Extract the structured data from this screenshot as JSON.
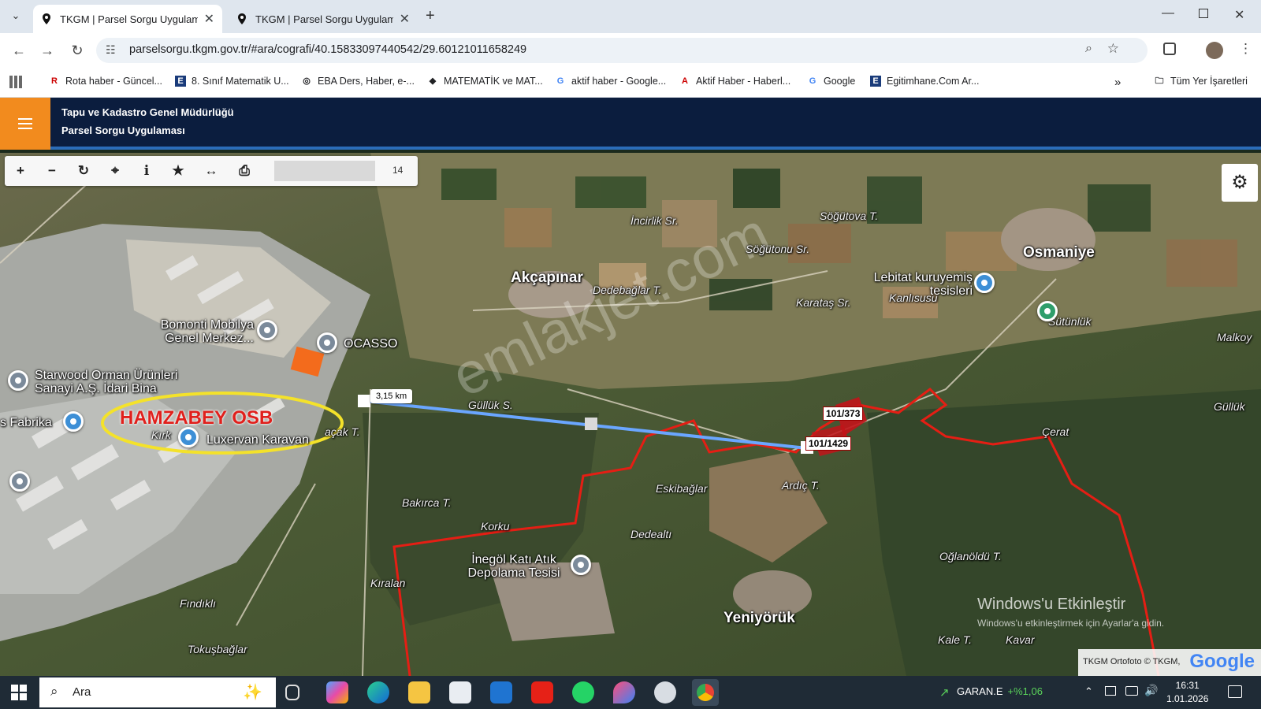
{
  "browser": {
    "tabs": [
      {
        "title": "TKGM | Parsel Sorgu Uygulama",
        "active": true
      },
      {
        "title": "TKGM | Parsel Sorgu Uygulama",
        "active": false
      }
    ],
    "new_tab_label": "+",
    "url": "parselsorgu.tkgm.gov.tr/#ara/cografi/40.15833097440542/29.60121011658249",
    "bookmarks": [
      {
        "label": "Rota haber - Güncel..."
      },
      {
        "label": "8. Sınıf Matematik U..."
      },
      {
        "label": "EBA Ders, Haber, e-..."
      },
      {
        "label": "MATEMATİK ve MAT..."
      },
      {
        "label": "aktif haber - Google..."
      },
      {
        "label": "Aktif Haber - Haberl..."
      },
      {
        "label": "Google"
      },
      {
        "label": "Egitimhane.Com Ar..."
      }
    ],
    "all_bookmarks_label": "Tüm Yer İşaretleri",
    "overflow_label": "»"
  },
  "app": {
    "org": "Tapu ve Kadastro Genel Müdürlüğü",
    "name": "Parsel Sorgu Uygulaması",
    "accent_color": "#f28b1e",
    "header_color": "#0b1d3e"
  },
  "map": {
    "zoom_level": "14",
    "tool_icons": [
      "zoom-in-icon",
      "zoom-out-icon",
      "refresh-icon",
      "locate-icon",
      "info-icon",
      "favorite-icon",
      "measure-icon",
      "print-icon"
    ],
    "measure_distance": "3,15 km",
    "annotation": "HAMZABEY OSB",
    "watermark": "emlakjet.com",
    "parcels": [
      "101/373",
      "101/1429"
    ],
    "places": {
      "akcapinar": "Akçapınar",
      "osmaniye": "Osmaniye",
      "yeniyoruk": "Yeniyörük",
      "incirlik": "İncirlik Sr.",
      "sogutova": "Söğütova T.",
      "sogutonu": "Söğütonu Sr.",
      "dedebaglar": "Dedebağlar T.",
      "karatas": "Karataş Sr.",
      "kanlisusu": "Kanlısusu",
      "sutunluk": "Sütünlük",
      "malkoy": "Malkoy",
      "gulluk_s": "Güllük S.",
      "gulluk": "Güllük",
      "cerat": "Çerat",
      "eskibaglar": "Eskibağlar",
      "ardic": "Ardıç T.",
      "bakirca": "Bakırca T.",
      "korku": "Korku",
      "dedealti": "Dedealtı",
      "kiralan": "Kıralan",
      "findikli": "Fındıklı",
      "oglanoldu": "Oğlanöldü T.",
      "kaleT": "Kale T.",
      "kavar": "Kavar",
      "tokusbaglar": "Tokuşbağlar",
      "kirk": "Kırk",
      "baskT": "açak T."
    },
    "pois": {
      "bomonti": "Bomonti Mobilya Genel Merkez...",
      "ocasso": "OCASSO",
      "starwood": "Starwood Orman Ürünleri Sanayi A.Ş. İdari Bina",
      "fabrika": "s Fabrika",
      "luxervan": "Luxervan Karavan",
      "lebitat": "Lebitat kuruyemiş tesisleri",
      "inegol": "İnegöl Katı Atık Depolama Tesisi"
    },
    "windows_activation_title": "Windows'u Etkinleştir",
    "windows_activation_sub": "Windows'u etkinleştirmek için Ayarlar'a gidin.",
    "attribution": "TKGM Ortofoto © TKGM,",
    "google_logo": "Google"
  },
  "taskbar": {
    "search_label": "Ara",
    "stock_symbol": "GARAN.E",
    "stock_change": "+%1,06",
    "time": "16:31",
    "date": "1.01.2026"
  }
}
